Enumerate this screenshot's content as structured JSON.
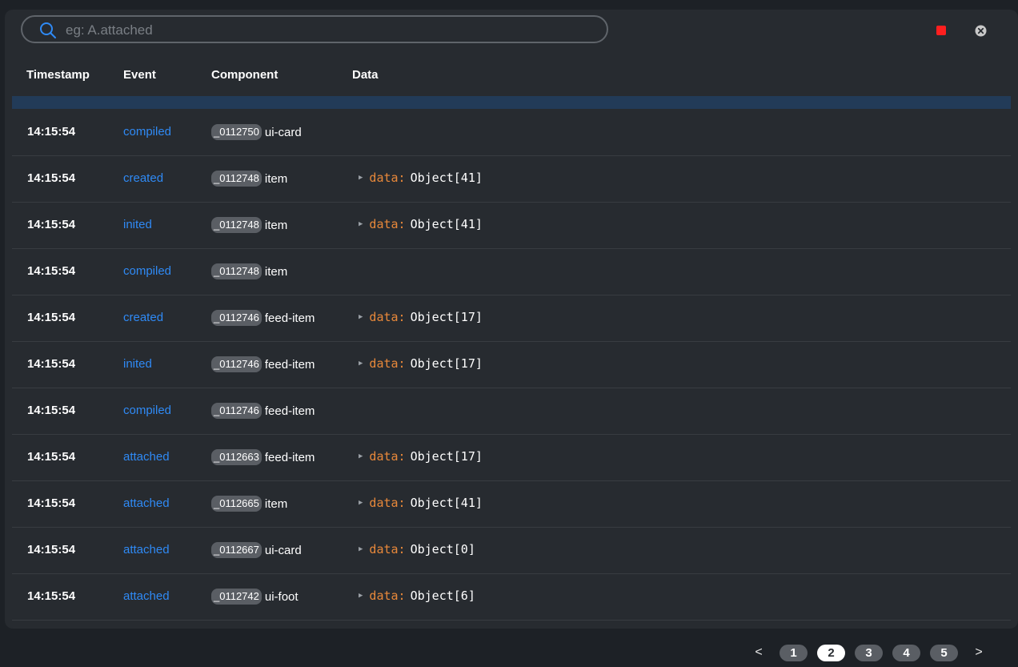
{
  "search": {
    "placeholder": "eg: A.attached",
    "value": ""
  },
  "toolbar": {
    "stop_color": "#ff1f1f",
    "stop_icon": "stop-square-icon",
    "clear_icon": "clear-circle-x-icon"
  },
  "columns": {
    "timestamp": "Timestamp",
    "event": "Event",
    "component": "Component",
    "data": "Data"
  },
  "colors": {
    "event_link": "#2f8af5",
    "data_key": "#e8883a",
    "selected_row": "#223b58",
    "badge": "#5a5e64"
  },
  "rows": [
    {
      "timestamp": "14:15:54",
      "event": "compiled",
      "id": "_0112750",
      "component": "ui-card",
      "data_key": "",
      "data_colon": "",
      "data_value": ""
    },
    {
      "timestamp": "14:15:54",
      "event": "created",
      "id": "_0112748",
      "component": "item",
      "data_key": "data",
      "data_colon": ":",
      "data_value": "Object[41]"
    },
    {
      "timestamp": "14:15:54",
      "event": "inited",
      "id": "_0112748",
      "component": "item",
      "data_key": "data",
      "data_colon": ":",
      "data_value": "Object[41]"
    },
    {
      "timestamp": "14:15:54",
      "event": "compiled",
      "id": "_0112748",
      "component": "item",
      "data_key": "",
      "data_colon": "",
      "data_value": ""
    },
    {
      "timestamp": "14:15:54",
      "event": "created",
      "id": "_0112746",
      "component": "feed-item",
      "data_key": "data",
      "data_colon": ":",
      "data_value": "Object[17]"
    },
    {
      "timestamp": "14:15:54",
      "event": "inited",
      "id": "_0112746",
      "component": "feed-item",
      "data_key": "data",
      "data_colon": ":",
      "data_value": "Object[17]"
    },
    {
      "timestamp": "14:15:54",
      "event": "compiled",
      "id": "_0112746",
      "component": "feed-item",
      "data_key": "",
      "data_colon": "",
      "data_value": ""
    },
    {
      "timestamp": "14:15:54",
      "event": "attached",
      "id": "_0112663",
      "component": "feed-item",
      "data_key": "data",
      "data_colon": ":",
      "data_value": "Object[17]"
    },
    {
      "timestamp": "14:15:54",
      "event": "attached",
      "id": "_0112665",
      "component": "item",
      "data_key": "data",
      "data_colon": ":",
      "data_value": "Object[41]"
    },
    {
      "timestamp": "14:15:54",
      "event": "attached",
      "id": "_0112667",
      "component": "ui-card",
      "data_key": "data",
      "data_colon": ":",
      "data_value": "Object[0]"
    },
    {
      "timestamp": "14:15:54",
      "event": "attached",
      "id": "_0112742",
      "component": "ui-foot",
      "data_key": "data",
      "data_colon": ":",
      "data_value": "Object[6]"
    }
  ],
  "pagination": {
    "prev_label": "<",
    "next_label": ">",
    "pages": [
      "1",
      "2",
      "3",
      "4",
      "5"
    ],
    "current": "2"
  }
}
